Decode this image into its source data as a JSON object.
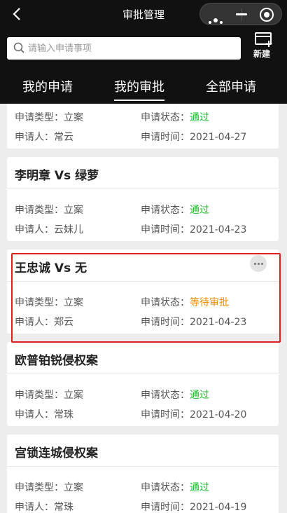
{
  "nav": {
    "title": "审批管理"
  },
  "search": {
    "placeholder": "请输入申请事项",
    "value": ""
  },
  "new_label": "新建",
  "tabs": [
    {
      "label": "我的申请",
      "active": false
    },
    {
      "label": "我的审批",
      "active": true
    },
    {
      "label": "全部申请",
      "active": false
    }
  ],
  "labels": {
    "type": "申请类型：",
    "status": "申请状态：",
    "person": "申请人：",
    "time": "申请时间："
  },
  "cards": [
    {
      "title": "",
      "type": "立案",
      "status": "通过",
      "person": "常云",
      "time": "2021-04-27"
    },
    {
      "title": "李明章 Vs 绿萝",
      "type": "立案",
      "status": "通过",
      "person": "云妹儿",
      "time": "2021-04-23"
    },
    {
      "title": "王忠诚 Vs 无",
      "type": "立案",
      "status": "等待审批",
      "person": "郑云",
      "time": "2021-04-23"
    },
    {
      "title": "欧普铂锐侵权案",
      "type": "立案",
      "status": "通过",
      "person": "常珠",
      "time": "2021-04-20"
    },
    {
      "title": "宫锁连城侵权案",
      "type": "立案",
      "status": "通过",
      "person": "常珠",
      "time": "2021-04-19"
    }
  ],
  "colors": {
    "header_bg": "#111111",
    "status_ok": "#19be2b",
    "status_wait": "#f08c00",
    "highlight": "#e01f1f"
  }
}
